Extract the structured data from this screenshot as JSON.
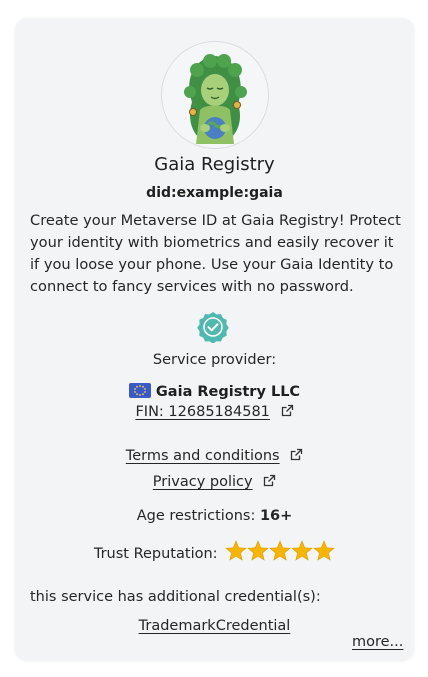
{
  "service": {
    "name": "Gaia Registry",
    "did": "did:example:gaia",
    "description": "Create your Metaverse ID at Gaia Registry! Protect your identity with biometrics and easily recover it if you loose your phone. Use your Gaia Identity to connect to fancy services with no password."
  },
  "provider": {
    "label": "Service provider:",
    "org_name": "Gaia Registry LLC",
    "fin": "FIN: 12685184581",
    "flag_icon": "eu-flag-icon"
  },
  "links": {
    "terms": "Terms and conditions",
    "privacy": "Privacy policy"
  },
  "age": {
    "label": "Age restrictions:",
    "value": "16+"
  },
  "trust": {
    "label": "Trust Reputation:",
    "stars": 5,
    "max_stars": 5,
    "star_color": "#f7b500"
  },
  "credentials": {
    "label": "this service has additional credential(s):",
    "items": [
      "TrademarkCredential"
    ],
    "more": "more..."
  },
  "colors": {
    "verified_badge": "#4fb8b1",
    "card_bg": "#f3f4f6"
  }
}
